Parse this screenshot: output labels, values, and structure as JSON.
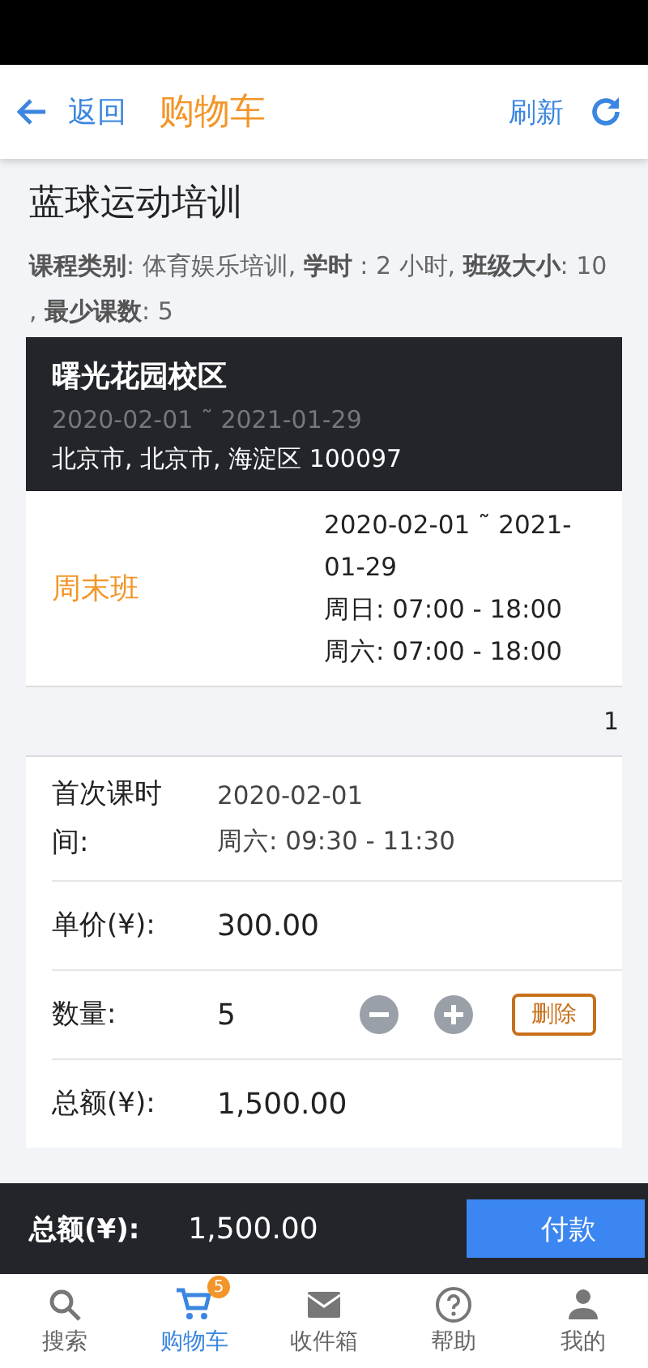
{
  "header": {
    "back": "返回",
    "title": "购物车",
    "refresh": "刷新"
  },
  "course": {
    "title": "蓝球运动培训",
    "meta": "**课程类别**: 体育娱乐培训, **学时** : 2 小时, **班级大小**: 10 , **最少课数**: 5"
  },
  "campus": {
    "name": "曙光花园校区",
    "dates": "2020-02-01 ˜ 2021-01-29",
    "address": "北京市, 北京市, 海淀区 100097"
  },
  "class": {
    "name": "周末班",
    "schedule": [
      "2020-02-01 ˜ 2021-01-29",
      "周日: 07:00 - 18:00",
      "周六: 07:00 - 18:00"
    ]
  },
  "index": "1",
  "details": [
    {
      "kind": "text",
      "label": "首次课时间:",
      "values": [
        "2020-02-01",
        "周六: 09:30 - 11:30"
      ]
    },
    {
      "kind": "text",
      "label": "单价(¥):",
      "values": [
        "300.00"
      ]
    },
    {
      "kind": "quantity",
      "label": "数量:",
      "values": [
        "5"
      ],
      "delete": "删除"
    },
    {
      "kind": "text",
      "label": "总额(¥):",
      "values": [
        "1,500.00"
      ]
    }
  ],
  "checkout": {
    "label": "总额(¥):",
    "total": "1,500.00",
    "pay": "付款"
  },
  "tabs": [
    {
      "label": "搜索",
      "selected": false
    },
    {
      "label": "购物车",
      "selected": true,
      "badge": "5"
    },
    {
      "label": "收件箱",
      "selected": false
    },
    {
      "label": "帮助",
      "selected": false
    },
    {
      "label": "我的",
      "selected": false
    }
  ]
}
